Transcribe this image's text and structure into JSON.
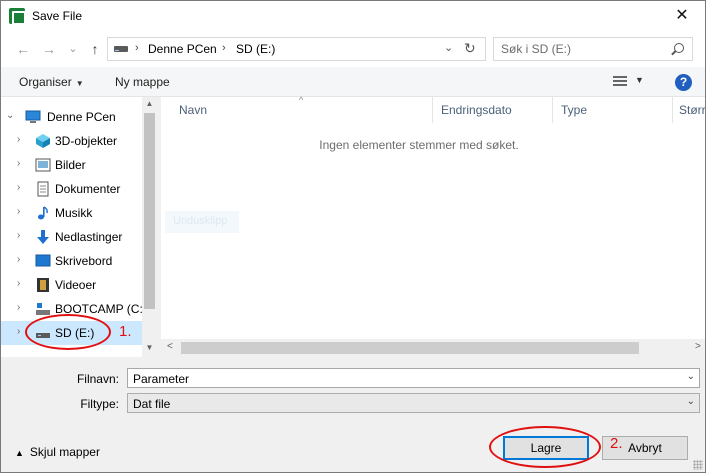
{
  "window": {
    "title": "Save File",
    "close_glyph": "✕"
  },
  "nav": {
    "back_glyph": "←",
    "forward_glyph": "→",
    "recent_glyph": "⌄",
    "up_glyph": "↑",
    "address": {
      "crumbs": [
        "Denne PCen",
        "SD (E:)"
      ],
      "separator": "›",
      "dropdown_glyph": "⌄",
      "refresh_glyph": "↻"
    },
    "search": {
      "placeholder": "Søk i SD (E:)"
    }
  },
  "toolbar": {
    "organize_label": "Organiser",
    "organize_caret": "▼",
    "new_folder_label": "Ny mappe",
    "view_caret": "▼",
    "help_glyph": "?"
  },
  "sidebar": {
    "root": {
      "label": "Denne PCen",
      "expander": "⌄",
      "icon": "computer-icon"
    },
    "items": [
      {
        "label": "3D-objekter",
        "expander": "›",
        "icon": "cube-3d-icon"
      },
      {
        "label": "Bilder",
        "expander": "›",
        "icon": "pictures-icon"
      },
      {
        "label": "Dokumenter",
        "expander": "›",
        "icon": "documents-icon"
      },
      {
        "label": "Musikk",
        "expander": "›",
        "icon": "music-icon"
      },
      {
        "label": "Nedlastinger",
        "expander": "›",
        "icon": "downloads-icon"
      },
      {
        "label": "Skrivebord",
        "expander": "›",
        "icon": "desktop-icon"
      },
      {
        "label": "Videoer",
        "expander": "›",
        "icon": "videos-icon"
      },
      {
        "label": "BOOTCAMP (C:)",
        "expander": "›",
        "icon": "system-drive-icon"
      },
      {
        "label": "SD (E:)",
        "expander": "›",
        "icon": "removable-drive-icon"
      }
    ],
    "scroll_up_glyph": "▲",
    "scroll_down_glyph": "▼"
  },
  "filelist": {
    "columns": [
      "Navn",
      "Endringsdato",
      "Type",
      "Størr"
    ],
    "sort_glyph": "^",
    "empty_message": "Ingen elementer stemmer med søket.",
    "ghost_text": "Undusklipp",
    "scroll_left_glyph": "<",
    "scroll_right_glyph": ">"
  },
  "form": {
    "filename_label": "Filnavn:",
    "filename_value": "Parameter",
    "filetype_label": "Filtype:",
    "filetype_value": "Dat file",
    "dropdown_glyph": "⌄"
  },
  "footer": {
    "hide_folders_caret": "▲",
    "hide_folders_label": "Skjul mapper",
    "save_label": "Lagre",
    "cancel_label": "Avbryt"
  },
  "annotations": {
    "step1": "1.",
    "step2": "2.",
    "color": "#e01010"
  },
  "colors": {
    "selected_bg": "#cce8ff",
    "accent": "#0078d7",
    "header_text": "#4c607a"
  }
}
